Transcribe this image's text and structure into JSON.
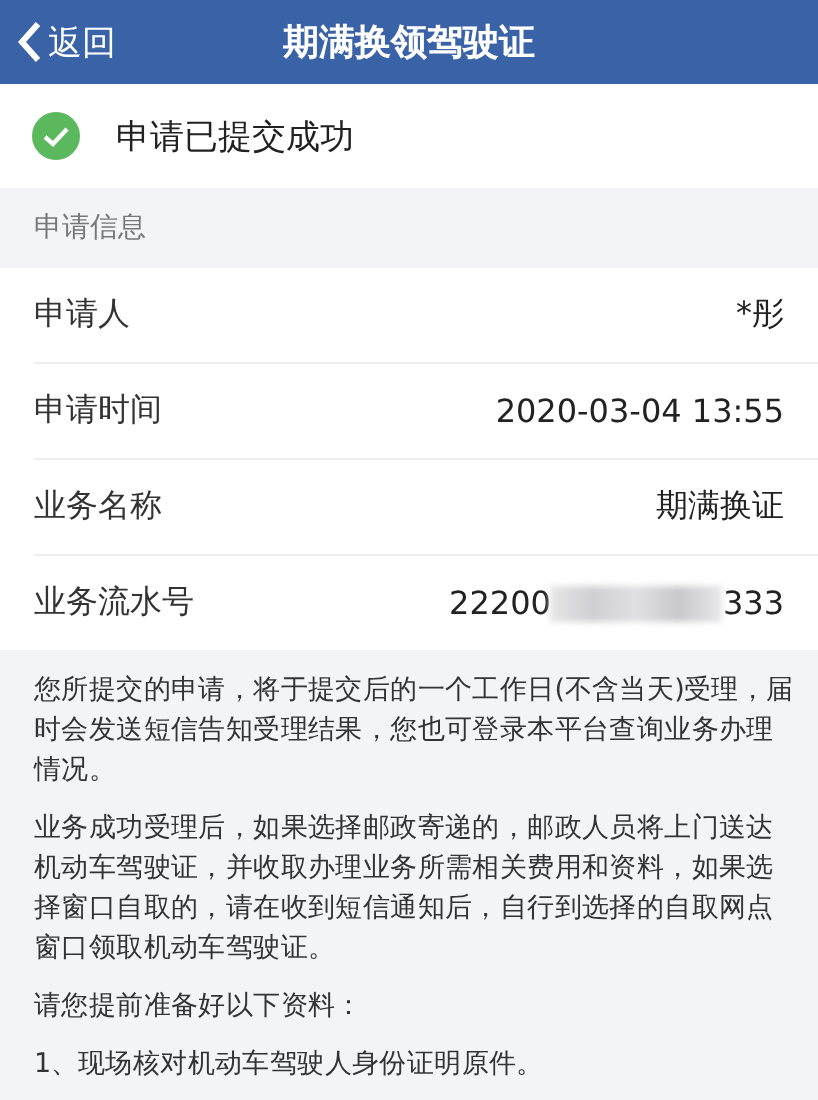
{
  "header": {
    "back": "返回",
    "title": "期满换领驾驶证"
  },
  "status": {
    "text": "申请已提交成功",
    "success": true
  },
  "section": {
    "title": "申请信息"
  },
  "rows": [
    {
      "label": "申请人",
      "value": "*彤"
    },
    {
      "label": "申请时间",
      "value": "2020-03-04 13:55"
    },
    {
      "label": "业务名称",
      "value": "期满换证"
    },
    {
      "label": "业务流水号",
      "value": "22200",
      "value_end": "333",
      "redacted": true
    }
  ],
  "notes": [
    "您所提交的申请，将于提交后的一个工作日(不含当天)受理，届时会发送短信告知受理结果，您也可登录本平台查询业务办理情况。",
    "业务成功受理后，如果选择邮政寄递的，邮政人员将上门送达机动车驾驶证，并收取办理业务所需相关费用和资料，如果选择窗口自取的，请在收到短信通知后，自行到选择的自取网点窗口领取机动车驾驶证。",
    "请您提前准备好以下资料：",
    "1、现场核对机动车驾驶人身份证明原件。"
  ]
}
